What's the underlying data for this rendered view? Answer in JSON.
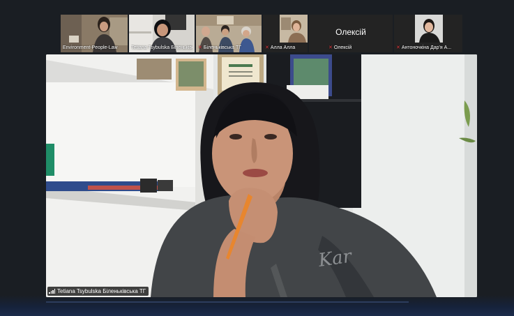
{
  "participants": [
    {
      "name": "Environment-People-Law",
      "muted": false,
      "active": false,
      "video": true
    },
    {
      "name": "Tetiana Tsybulska Біленьківська ТГ",
      "muted": false,
      "active": true,
      "video": true
    },
    {
      "name": "Біленьківська ТГ",
      "muted": true,
      "active": false,
      "video": true
    },
    {
      "name": "Алла Алла",
      "muted": true,
      "active": false,
      "video": true
    },
    {
      "name": "Олексій",
      "muted": true,
      "active": false,
      "video": false,
      "display_name": "Олексій"
    },
    {
      "name": "Антоночкіна Дар'я А...",
      "muted": true,
      "active": false,
      "video": true
    }
  ],
  "active_speaker": {
    "name": "Tetiana Tsybulska Біленьківська ТГ"
  },
  "colors": {
    "accent_active": "#2eb84a",
    "muted_mic": "#e0383e",
    "background": "#1a1e23"
  }
}
